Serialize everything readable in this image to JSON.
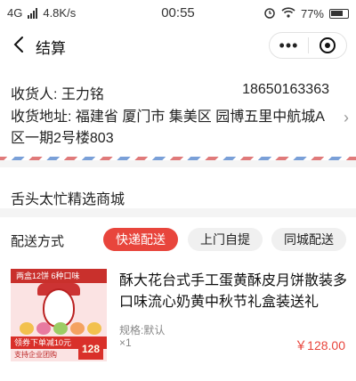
{
  "status_bar": {
    "network": "4G",
    "speed": "4.8K/s",
    "time": "00:55",
    "battery": "77%",
    "icons": [
      "signal-icon",
      "alarm-icon",
      "wifi-icon",
      "battery-icon"
    ]
  },
  "nav": {
    "title": "结算",
    "more": "•••"
  },
  "address": {
    "receiver": "收货人: 王力铭",
    "phone": "18650163363",
    "detail": "收货地址: 福建省 厦门市 集美区 园博五里中航城A区一期2号楼803",
    "arrow": "›"
  },
  "shop": {
    "name": "舌头太忙精选商城"
  },
  "delivery": {
    "label": "配送方式",
    "options": [
      "快递配送",
      "上门自提",
      "同城配送"
    ],
    "selected_index": 0
  },
  "product": {
    "image_band": "两盒12饼  6种口味",
    "image_promo": "领券下单减10元",
    "image_promo_sub": "支持企业团购",
    "image_price": "128",
    "name": "酥大花台式手工蛋黄酥皮月饼散装多口味流心奶黄中秋节礼盒装送礼",
    "spec": "规格:默认",
    "quantity": "×1",
    "price": "￥128.00"
  },
  "colors": {
    "accent": "#e8453c",
    "airmail_red": "#e07a7a",
    "airmail_blue": "#7aa0d8"
  }
}
